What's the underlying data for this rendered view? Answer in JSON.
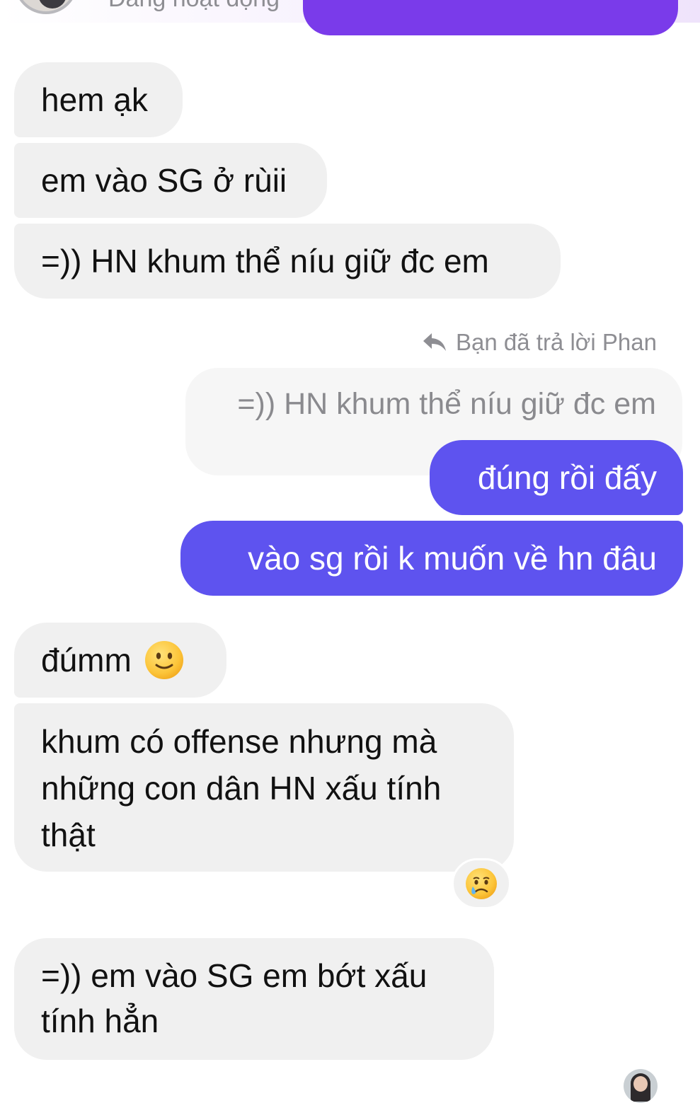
{
  "header": {
    "status_text": "Đang hoạt động"
  },
  "messages": {
    "m1": "hem ạk",
    "m2": "em vào SG ở rùii",
    "m3": "=)) HN khum thể níu giữ đc em",
    "reply_meta": "Bạn đã trả lời Phan",
    "quoted": "=)) HN khum thể níu giữ đc em",
    "m4": "đúng rồi đấy",
    "m5": "vào sg rồi k muốn về hn đâu",
    "m6": "đúmm",
    "m7": "khum có offense nhưng mà những con dân HN xấu tính thật",
    "m8": "=)) em vào SG em bớt xấu tính hẳn"
  },
  "icons": {
    "reply": "reply-arrow-icon",
    "smile_emoji": "slightly-smiling-face-emoji",
    "reaction_emoji": "crying-face-emoji"
  },
  "colors": {
    "incoming_bubble": "#f0f0f0",
    "outgoing_bubble": "#5e53ef",
    "top_outgoing_bubble": "#7a3bea",
    "meta_text": "#8e8e93"
  }
}
